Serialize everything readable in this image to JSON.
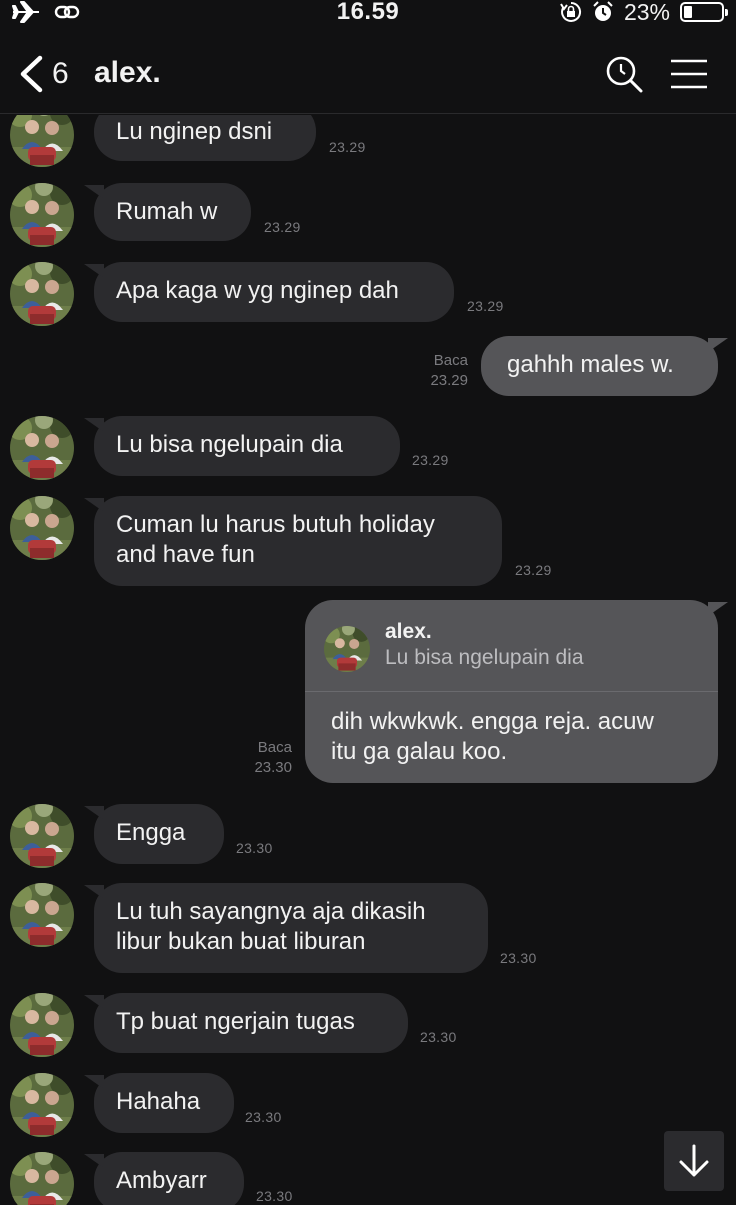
{
  "status_bar": {
    "time": "16.59",
    "battery": "23%",
    "battery_level": 0.23,
    "icons": [
      "airplane-icon",
      "link-icon",
      "rotation-lock-icon",
      "alarm-icon",
      "battery-icon"
    ]
  },
  "header": {
    "back_count": "6",
    "title": "alex.",
    "icons": [
      "back-chevron-icon",
      "search-icon",
      "menu-icon"
    ]
  },
  "messages": [
    {
      "dir": "in",
      "text": "Lu nginep dsni",
      "time": "23.29"
    },
    {
      "dir": "in",
      "text": "Rumah w",
      "time": "23.29"
    },
    {
      "dir": "in",
      "text": "Apa kaga w yg nginep dah",
      "time": "23.29"
    },
    {
      "dir": "out",
      "text": "gahhh males w.",
      "read": "Baca",
      "time": "23.29"
    },
    {
      "dir": "in",
      "text": "Lu bisa ngelupain dia",
      "time": "23.29"
    },
    {
      "dir": "in",
      "text": "Cuman lu harus butuh holiday\nand have fun",
      "time": "23.29"
    },
    {
      "dir": "out",
      "reply_name": "alex.",
      "reply_quote": "Lu bisa ngelupain dia",
      "text": "dih wkwkwk. engga reja. acuw\nitu ga galau koo.",
      "read": "Baca",
      "time": "23.30"
    },
    {
      "dir": "in",
      "text": "Engga",
      "time": "23.30"
    },
    {
      "dir": "in",
      "text": "Lu tuh sayangnya aja dikasih\nlibur bukan buat liburan",
      "time": "23.30"
    },
    {
      "dir": "in",
      "text": "Tp buat ngerjain tugas",
      "time": "23.30"
    },
    {
      "dir": "in",
      "text": "Hahaha",
      "time": "23.30"
    },
    {
      "dir": "in",
      "text": "Ambyarr",
      "time": "23.30"
    }
  ],
  "colors": {
    "background": "#111112",
    "incoming_bubble": "#2b2b2e",
    "outgoing_bubble": "#555558",
    "timestamp": "#7a7a7e"
  }
}
